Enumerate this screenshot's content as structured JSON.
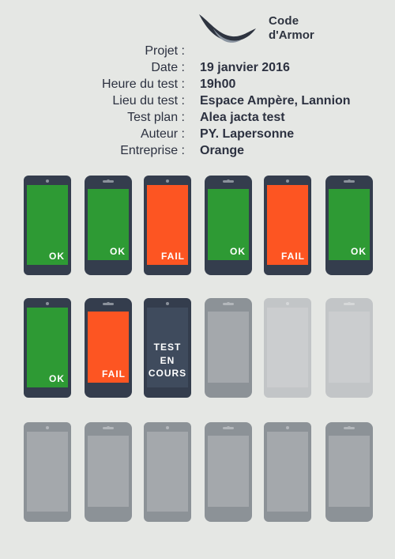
{
  "logo": {
    "line1": "Code",
    "line2": "d'Armor"
  },
  "info": [
    {
      "key": "Projet :",
      "value": ""
    },
    {
      "key": "Date :",
      "value": "19 janvier 2016"
    },
    {
      "key": "Heure du test :",
      "value": "19h00"
    },
    {
      "key": "Lieu du test :",
      "value": "Espace Ampère, Lannion"
    },
    {
      "key": "Test plan :",
      "value": "Alea jacta test"
    },
    {
      "key": "Auteur :",
      "value": "PY. Lapersonne"
    },
    {
      "key": "Entreprise :",
      "value": "Orange"
    }
  ],
  "colors": {
    "ok": "#2e9a34",
    "fail": "#fd5522",
    "test": "#3f4b5d",
    "phone_dark": "#343d4d",
    "phone_gray": "#8c9297",
    "phone_light": "#c2c5c7"
  },
  "devices": [
    {
      "shape": "android",
      "status": "ok",
      "label": "OK"
    },
    {
      "shape": "iphone",
      "status": "ok",
      "label": "OK"
    },
    {
      "shape": "android",
      "status": "fail",
      "label": "FAIL"
    },
    {
      "shape": "iphone",
      "status": "ok",
      "label": "OK"
    },
    {
      "shape": "android",
      "status": "fail",
      "label": "FAIL"
    },
    {
      "shape": "iphone",
      "status": "ok",
      "label": "OK"
    },
    {
      "shape": "android",
      "status": "ok",
      "label": "OK"
    },
    {
      "shape": "iphone",
      "status": "fail",
      "label": "FAIL"
    },
    {
      "shape": "android",
      "status": "test",
      "label": "TEST EN COURS"
    },
    {
      "shape": "iphone",
      "status": "pending",
      "label": ""
    },
    {
      "shape": "android",
      "status": "pending-light",
      "label": ""
    },
    {
      "shape": "iphone",
      "status": "pending-light",
      "label": ""
    },
    {
      "shape": "android",
      "status": "pending",
      "label": ""
    },
    {
      "shape": "iphone",
      "status": "pending",
      "label": ""
    },
    {
      "shape": "android",
      "status": "pending",
      "label": ""
    },
    {
      "shape": "iphone",
      "status": "pending",
      "label": ""
    },
    {
      "shape": "android",
      "status": "pending",
      "label": ""
    },
    {
      "shape": "iphone",
      "status": "pending",
      "label": ""
    }
  ]
}
